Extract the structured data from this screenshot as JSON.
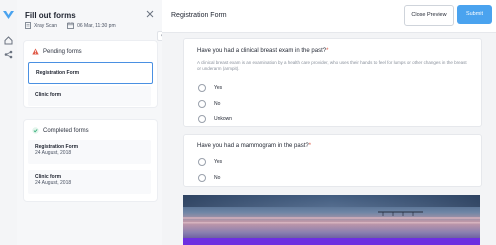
{
  "panel": {
    "title": "Fill out forms",
    "patient": "Xray Scan",
    "datetime": "06 Mar, 11:30 pm"
  },
  "pending": {
    "heading": "Pending forms",
    "items": [
      {
        "name": "Registration Form"
      },
      {
        "name": "Clinic form"
      }
    ]
  },
  "completed": {
    "heading": "Completed forms",
    "items": [
      {
        "name": "Registration Form",
        "date": "24 August, 2018"
      },
      {
        "name": "Clinic form",
        "date": "24 August, 2018"
      }
    ]
  },
  "header": {
    "title": "Registration Form",
    "preview_label": "Close Preview",
    "submit_label": "Submit"
  },
  "questions": [
    {
      "text": "Have you had a clinical breast exam in the past?",
      "required": "*",
      "description": "A clinical breast exam is an examination by a health care provider, who uses their hands to feel for lumps or other changes in the breast or underarm (armpit).",
      "options": [
        "Yes",
        "No",
        "Unkown"
      ]
    },
    {
      "text": "Have you had a mammogram in the past?",
      "required": "*",
      "options": [
        "Yes",
        "No"
      ]
    }
  ],
  "collapse_glyph": "«",
  "colors": {
    "accent": "#4aa3ef",
    "selected_border": "#4a90e2",
    "warning": "#e05a47",
    "success": "#3fb37f"
  },
  "icons": {
    "logo": "logo-icon",
    "nav": [
      "home-icon",
      "share-icon"
    ],
    "close": "close-icon",
    "patient": "document-icon",
    "date": "calendar-icon",
    "pending": "warning-icon",
    "completed": "check-circle-icon"
  }
}
